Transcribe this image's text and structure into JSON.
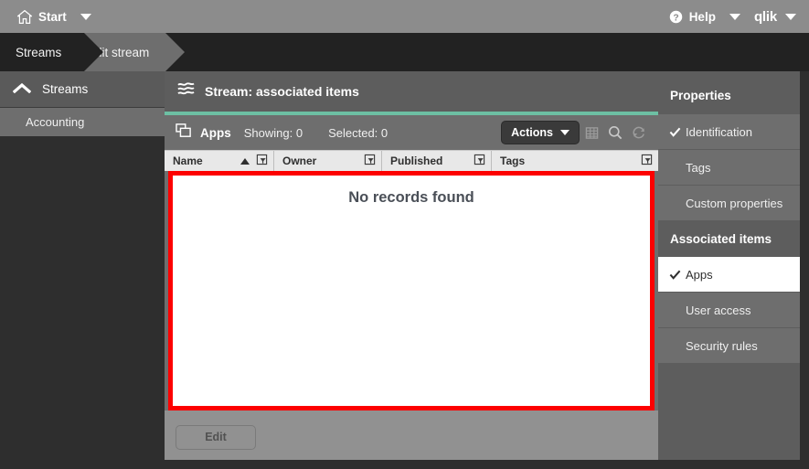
{
  "topbar": {
    "home_icon": "home-icon",
    "start_label": "Start",
    "start_caret": "chevron-down-icon",
    "help_icon": "help-circle-icon",
    "help_label": "Help",
    "help_caret": "chevron-down-icon",
    "brand_label": "qlik",
    "brand_caret": "chevron-down-icon"
  },
  "breadcrumb": {
    "items": [
      {
        "label": "Streams",
        "active": false
      },
      {
        "label": "Edit stream",
        "active": true
      }
    ]
  },
  "sidebar": {
    "header": {
      "label": "Streams",
      "icon": "chevron-up-icon"
    },
    "items": [
      {
        "label": "Accounting"
      }
    ]
  },
  "main": {
    "header": {
      "icon": "stream-icon",
      "title": "Stream: associated items"
    },
    "accent_color": "#6dbfa3",
    "toolbar": {
      "apps_icon": "apps-icon",
      "apps_label": "Apps",
      "showing_label": "Showing: 0",
      "selected_label": "Selected: 0",
      "actions_label": "Actions",
      "actions_caret": "chevron-down-icon",
      "columns_icon": "table-columns-icon",
      "search_icon": "search-icon",
      "refresh_icon": "refresh-icon"
    },
    "table": {
      "columns": [
        {
          "label": "Name",
          "sort": "asc",
          "filter_icon": "filter-icon"
        },
        {
          "label": "Owner",
          "sort": "",
          "filter_icon": "filter-icon"
        },
        {
          "label": "Published",
          "sort": "",
          "filter_icon": "filter-icon"
        },
        {
          "label": "Tags",
          "sort": "",
          "filter_icon": "filter-icon"
        }
      ],
      "rows": [],
      "empty_message": "No records found",
      "highlight_color": "#fd0000"
    },
    "footer": {
      "edit_label": "Edit",
      "edit_disabled": true
    }
  },
  "properties_panel": {
    "title": "Properties",
    "properties": [
      {
        "label": "Identification",
        "checked": true
      },
      {
        "label": "Tags",
        "checked": false
      },
      {
        "label": "Custom properties",
        "checked": false
      }
    ],
    "associated_title": "Associated items",
    "associated": [
      {
        "label": "Apps",
        "checked": true,
        "selected": true
      },
      {
        "label": "User access",
        "checked": false,
        "selected": false
      },
      {
        "label": "Security rules",
        "checked": false,
        "selected": false
      }
    ]
  }
}
